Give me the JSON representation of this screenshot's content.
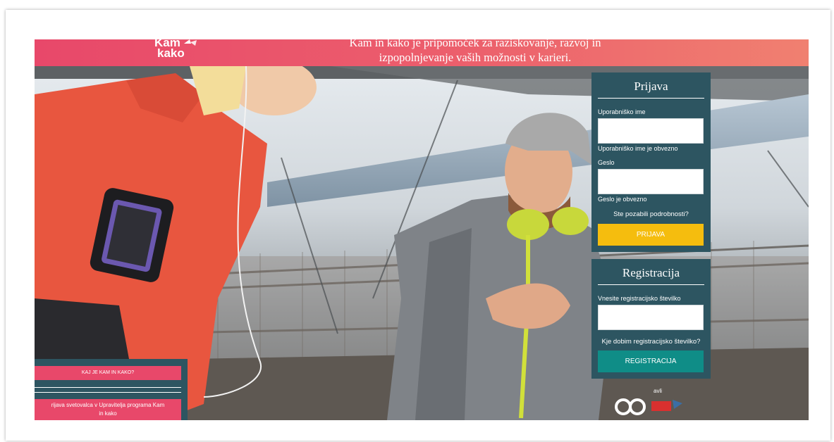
{
  "header": {
    "logo_line1": "Kam",
    "logo_line2": "kako",
    "tagline_line1": "Kam in kako je pripomoček za raziskovanje, razvoj in",
    "tagline_line2": "izpopolnjevanje vaših možnosti v karieri."
  },
  "login": {
    "title": "Prijava",
    "username_label": "Uporabniško ime",
    "username_value": "",
    "username_error": "Uporabniško ime je obvezno",
    "password_label": "Geslo",
    "password_value": "",
    "password_error": "Geslo je obvezno",
    "forgot_link": "Ste pozabili podrobnosti?",
    "submit_label": "PRIJAVA"
  },
  "registration": {
    "title": "Registracija",
    "code_label": "Vnesite registracijsko številko",
    "code_value": "",
    "where_link": "Kje dobim registracijsko številko?",
    "submit_label": "REGISTRACIJA"
  },
  "faq": {
    "what_label": "KAJ JE KAM IN KAKO?",
    "advisor_line1": "rijava svetovalca v Upravitelja programa Kam",
    "advisor_line2": "in kako"
  },
  "partner": {
    "text": "avli"
  },
  "colors": {
    "header_start": "#e8486a",
    "header_end": "#f08070",
    "panel": "#2d5561",
    "login_button": "#f5bd0e",
    "register_button": "#0f8d87",
    "faq_button": "#e8486a"
  }
}
